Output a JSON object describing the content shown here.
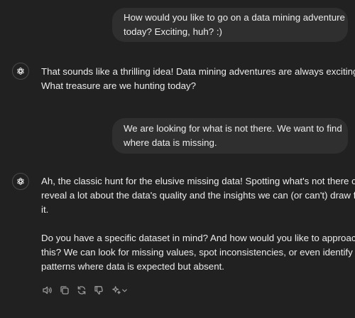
{
  "conversation": {
    "messages": [
      {
        "role": "user",
        "lines": [
          "How would you like to go on a data mining adventure",
          "today? Exciting, huh? :)"
        ]
      },
      {
        "role": "assistant",
        "lines": [
          "That sounds like a thrilling idea! Data mining adventures are always exciting.",
          "What treasure are we hunting today?"
        ]
      },
      {
        "role": "user",
        "lines": [
          "We are looking for what is not there. We want to find",
          "where data is missing."
        ]
      },
      {
        "role": "assistant",
        "paragraphs": [
          {
            "lines": [
              "Ah, the classic hunt for the elusive missing data! Spotting what's not there can",
              "reveal a lot about the data's quality and the insights we can (or can't) draw from",
              "it."
            ]
          },
          {
            "lines": [
              "Do you have a specific dataset in mind? And how would you like to approach",
              "this? We can look for missing values, spot inconsistencies, or even identify",
              "patterns where data is expected but absent."
            ]
          }
        ]
      }
    ]
  },
  "actions": {
    "icons": [
      "read-aloud-icon",
      "copy-icon",
      "regenerate-icon",
      "thumbs-down-icon",
      "sparkle-icon",
      "chevron-down-icon"
    ]
  },
  "colors": {
    "background": "#212121",
    "user_bubble": "#2f2f2f",
    "text": "#ececec",
    "icon": "#9b9b9b"
  }
}
